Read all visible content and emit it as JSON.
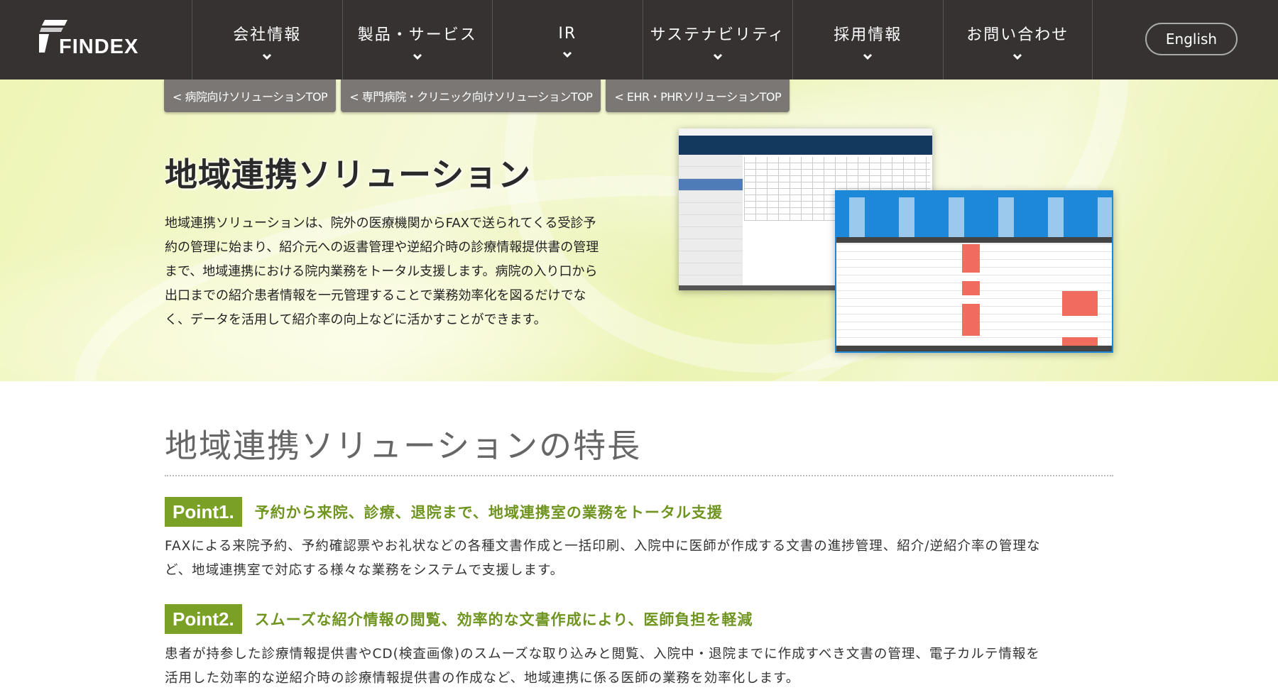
{
  "header": {
    "logo_text": "FINDEX",
    "nav": [
      {
        "label": "会社情報"
      },
      {
        "label": "製品・サービス"
      },
      {
        "label": "IR"
      },
      {
        "label": "サステナビリティ"
      },
      {
        "label": "採用情報"
      },
      {
        "label": "お問い合わせ"
      }
    ],
    "english_label": "English"
  },
  "subnav": [
    {
      "label": "< 病院向けソリューションTOP"
    },
    {
      "label": "< 専門病院・クリニック向けソリューションTOP"
    },
    {
      "label": "< EHR・PHRソリューションTOP"
    }
  ],
  "hero": {
    "title": "地域連携ソリューション",
    "lines": [
      "地域連携ソリューションは、院外の医療機関からFAXで送られてくる受診予",
      "約の管理に始まり、紹介元への返書管理や逆紹介時の診療情報提供書の管理",
      "まで、地域連携における院内業務をトータル支援します。病院の入り口から",
      "出口までの紹介患者情報を一元管理することで業務効率化を図るだけでな",
      "く、データを活用して紹介率の向上などに活かすことができます。"
    ]
  },
  "features": {
    "title": "地域連携ソリューションの特長",
    "points": [
      {
        "badge": "Point1.",
        "title": "予約から来院、診療、退院まで、地域連携室の業務をトータル支援",
        "lines": [
          "FAXによる来院予約、予約確認票やお礼状などの各種文書作成と一括印刷、入院中に医師が作成する文書の進捗管理、紹介/逆紹介率の管理な",
          "ど、地域連携室で対応する様々な業務をシステムで支援します。"
        ]
      },
      {
        "badge": "Point2.",
        "title": "スムーズな紹介情報の閲覧、効率的な文書作成により、医師負担を軽減",
        "lines": [
          "患者が持参した診療情報提供書やCD(検査画像)のスムーズな取り込みと閲覧、入院中・退院までに作成すべき文書の管理、電子カルテ情報を",
          "活用した効率的な逆紹介時の診療情報提供書の作成など、地域連携に係る医師の業務を効率化します。"
        ]
      }
    ]
  },
  "colors": {
    "header_bg": "#363232",
    "accent_green": "#7aa025",
    "heading_green": "#6f9520",
    "tab_gray": "#7a7775"
  }
}
